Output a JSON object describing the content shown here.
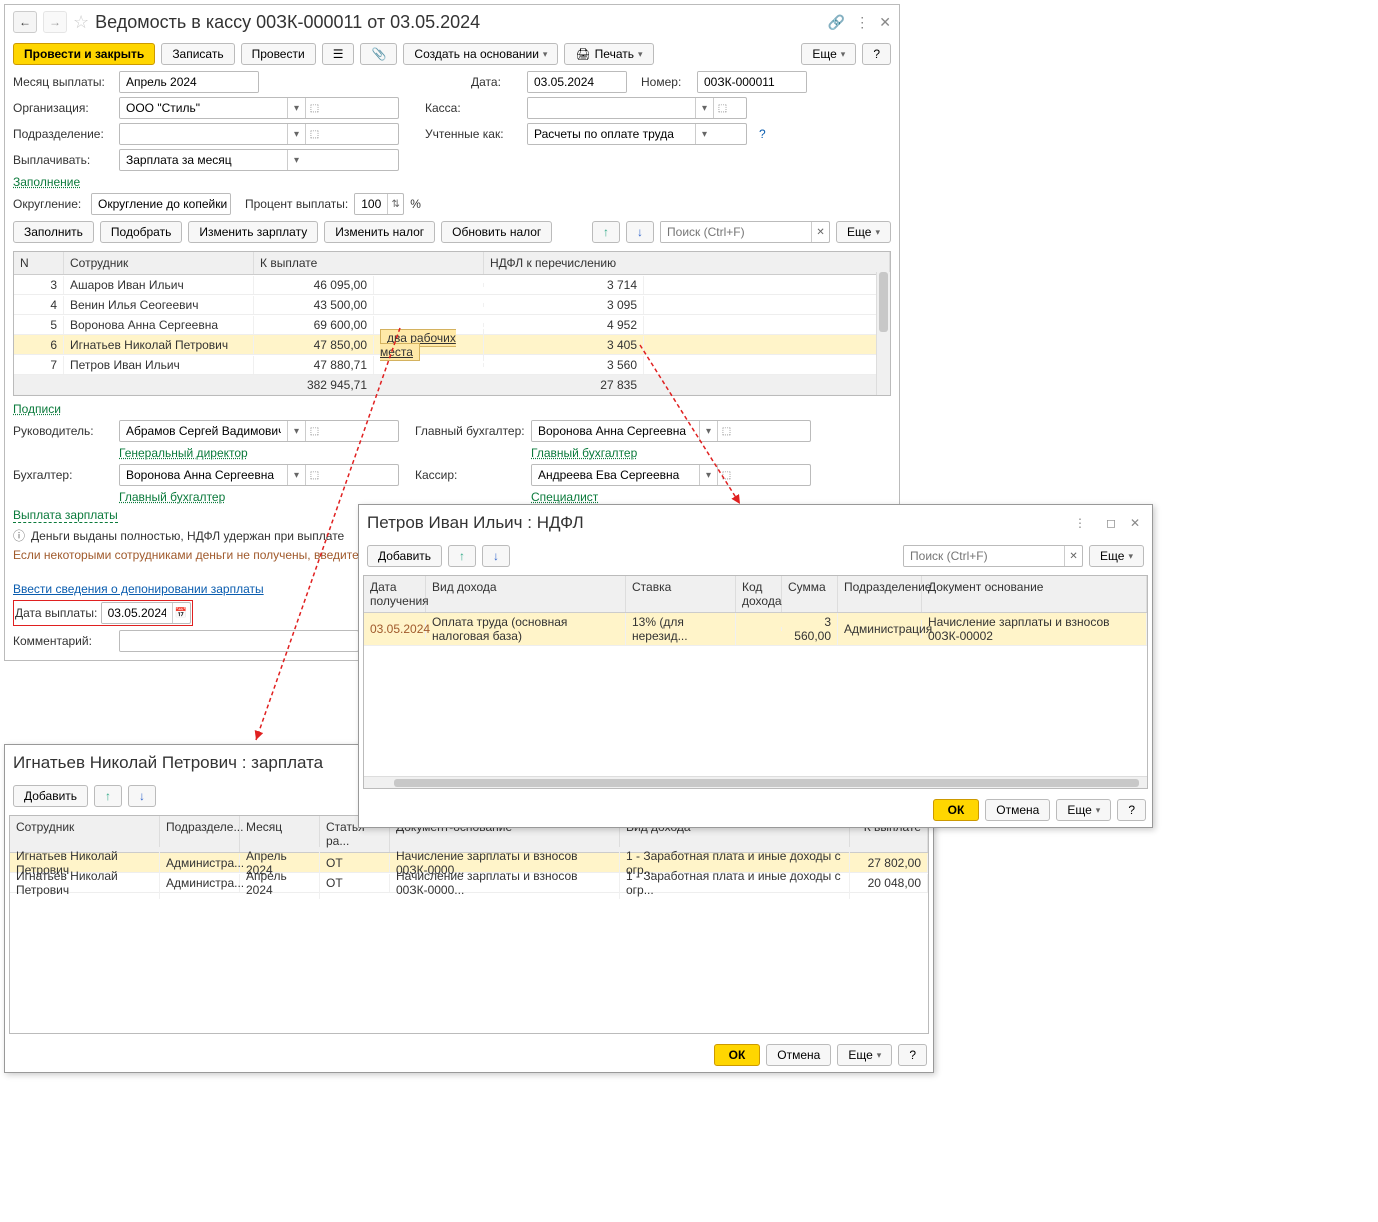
{
  "title": "Ведомость в кассу 00ЗК-000011 от 03.05.2024",
  "toolbar": {
    "main": "Провести и закрыть",
    "save": "Записать",
    "post": "Провести",
    "create_basis": "Создать на основании",
    "print": "Печать",
    "more": "Еще",
    "help": "?"
  },
  "fields": {
    "month_lbl": "Месяц выплаты:",
    "month": "Апрель 2024",
    "date_lbl": "Дата:",
    "date": "03.05.2024",
    "number_lbl": "Номер:",
    "number": "00ЗК-000011",
    "org_lbl": "Организация:",
    "org": "ООО \"Стиль\"",
    "cash_lbl": "Касса:",
    "dept_lbl": "Подразделение:",
    "accounted_lbl": "Учтенные как:",
    "accounted": "Расчеты по оплате труда",
    "pay_lbl": "Выплачивать:",
    "pay": "Зарплата за месяц",
    "filling": "Заполнение",
    "round_lbl": "Округление:",
    "round": "Округление до копейки",
    "percent_lbl": "Процент выплаты:",
    "percent": "100",
    "percent_sign": "%"
  },
  "action_buttons": {
    "fill": "Заполнить",
    "pick": "Подобрать",
    "edit_salary": "Изменить зарплату",
    "edit_tax": "Изменить налог",
    "update_tax": "Обновить налог",
    "search_ph": "Поиск (Ctrl+F)",
    "more": "Еще"
  },
  "table": {
    "headers": {
      "n": "N",
      "emp": "Сотрудник",
      "pay": "К выплате",
      "ndfl": "НДФЛ к перечислению"
    },
    "rows": [
      {
        "n": "3",
        "emp": "Ашаров Иван Ильич",
        "pay": "46 095,00",
        "ndfl": "3 714"
      },
      {
        "n": "4",
        "emp": "Венин Илья Сеогеевич",
        "pay": "43 500,00",
        "ndfl": "3 095"
      },
      {
        "n": "5",
        "emp": "Воронова Анна Сергеевна",
        "pay": "69 600,00",
        "ndfl": "4 952"
      },
      {
        "n": "6",
        "emp": "Игнатьев Николай Петрович",
        "pay": "47 850,00",
        "tag": "два рабочих места",
        "ndfl": "3 405",
        "hl": true
      },
      {
        "n": "7",
        "emp": "Петров Иван Ильич",
        "pay": "47 880,71",
        "ndfl": "3 560"
      }
    ],
    "totals": {
      "pay": "382 945,71",
      "ndfl": "27 835"
    }
  },
  "signs": {
    "link": "Подписи",
    "head_lbl": "Руководитель:",
    "head": "Абрамов Сергей Вадимович",
    "head_role": "Генеральный директор",
    "chief_lbl": "Главный бухгалтер:",
    "chief": "Воронова Анна Сергеевна",
    "chief_role": "Главный бухгалтер",
    "acc_lbl": "Бухгалтер:",
    "acc": "Воронова Анна Сергеевна",
    "acc_role": "Главный бухгалтер",
    "cashier_lbl": "Кассир:",
    "cashier": "Андреева Ева Сергеевна",
    "cashier_role": "Специалист"
  },
  "pay_section": {
    "title": "Выплата зарплаты",
    "info": "Деньги выданы полностью, НДФЛ удержан при выплате",
    "warn": "Если некоторыми сотрудниками деньги не получены, введите информ",
    "depo": "Ввести сведения о депонировании зарплаты",
    "date_lbl": "Дата выплаты:",
    "date": "03.05.2024",
    "comment_lbl": "Комментарий:"
  },
  "salary_popup": {
    "title": "Игнатьев Николай Петрович : зарплата",
    "add": "Добавить",
    "headers": {
      "emp": "Сотрудник",
      "dept": "Подразделе...",
      "month": "Месяц",
      "art": "Статья ра...",
      "doc": "Документ-основание",
      "income": "Вид дохода",
      "pay": "К выплате"
    },
    "rows": [
      {
        "emp": "Игнатьев Николай Петрович",
        "dept": "Администра...",
        "month": "Апрель 2024",
        "art": "ОТ",
        "doc": "Начисление зарплаты и взносов 00ЗК-0000...",
        "income": "1 - Заработная плата и иные доходы с огр...",
        "pay": "27 802,00",
        "hl": true
      },
      {
        "emp": "Игнатьев Николай Петрович",
        "dept": "Администра...",
        "month": "Апрель 2024",
        "art": "ОТ",
        "doc": "Начисление зарплаты и взносов 00ЗК-0000...",
        "income": "1 - Заработная плата и иные доходы с огр...",
        "pay": "20 048,00"
      }
    ],
    "ok": "ОК",
    "cancel": "Отмена",
    "more": "Еще",
    "help": "?"
  },
  "ndfl_popup": {
    "title": "Петров Иван Ильич : НДФЛ",
    "add": "Добавить",
    "search_ph": "Поиск (Ctrl+F)",
    "more": "Еще",
    "headers": {
      "date": "Дата получения",
      "income": "Вид дохода",
      "rate": "Ставка",
      "code": "Код дохода",
      "sum": "Сумма",
      "dept": "Подразделение",
      "doc": "Документ основание"
    },
    "row": {
      "date": "03.05.2024",
      "income": "Оплата труда (основная налоговая база)",
      "rate": "13% (для нерезид...",
      "sum": "3 560,00",
      "dept": "Администрация",
      "doc": "Начисление зарплаты и взносов 00ЗК-00002"
    },
    "ok": "ОК",
    "cancel": "Отмена",
    "help": "?"
  }
}
